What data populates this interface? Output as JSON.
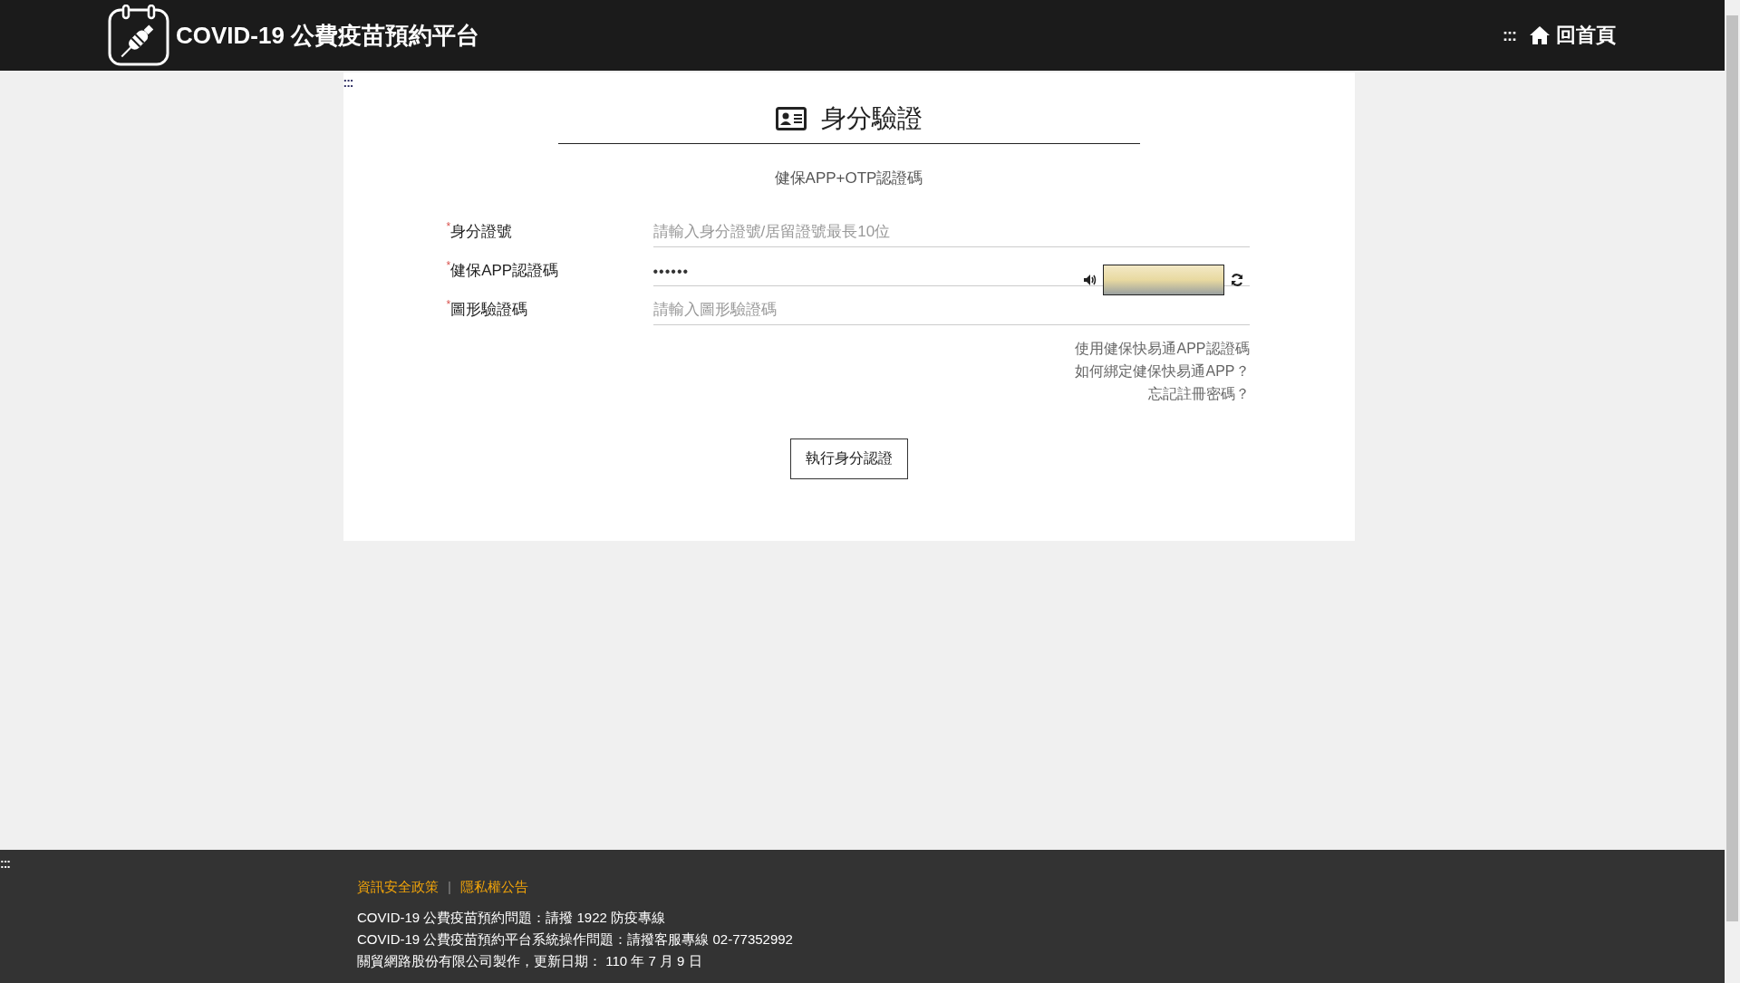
{
  "header": {
    "title": "COVID-19 公費疫苗預約平台",
    "skip_mark": ":::",
    "home_link": "回首頁"
  },
  "card": {
    "skip_mark": ":::",
    "title": "身分驗證",
    "subtitle": "健保APP+OTP認證碼",
    "fields": [
      {
        "kind": "text",
        "required_mark": "*",
        "label": "身分證號",
        "placeholder": "請輸入身分證號/居留證號最長10位"
      },
      {
        "kind": "password",
        "required_mark": "*",
        "label": "健保APP認證碼",
        "value": "••••••"
      },
      {
        "kind": "captcha",
        "required_mark": "*",
        "label": "圖形驗證碼",
        "placeholder": "請輸入圖形驗證碼"
      }
    ],
    "links": [
      "使用健保快易通APP認證碼",
      "如何綁定健保快易通APP？",
      "忘記註冊密碼？"
    ],
    "submit": "執行身分認證"
  },
  "footer": {
    "skip_mark": ":::",
    "links": [
      "資訊安全政策",
      "隱私權公告"
    ],
    "separator": "|",
    "lines": [
      "COVID-19 公費疫苗預約問題：請撥 1922 防疫專線",
      "COVID-19 公費疫苗預約平台系統操作問題：請撥客服專線 02-77352992",
      "關貿網路股份有限公司製作，更新日期： 110 年 7 月 9 日"
    ]
  }
}
